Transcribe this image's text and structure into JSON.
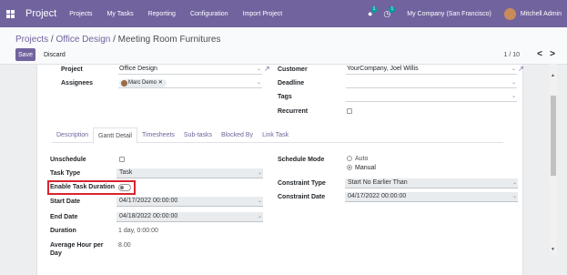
{
  "navbar": {
    "app_name": "Project",
    "menu": [
      "Projects",
      "My Tasks",
      "Reporting",
      "Configuration",
      "Import Project"
    ],
    "messages_badge": "1",
    "activity_badge": "1",
    "company": "My Company (San Francisco)",
    "user": "Mitchell Admin"
  },
  "control": {
    "breadcrumb_parent": "Projects",
    "breadcrumb_sep": " / ",
    "breadcrumb_middle": "Office Design",
    "breadcrumb_current": "Meeting Room Furnitures",
    "save_label": "Save",
    "discard_label": "Discard",
    "pager": "1 / 10",
    "prev": "<",
    "next": ">"
  },
  "form": {
    "project_label": "Project",
    "project_value": "Office Design",
    "assignees_label": "Assignees",
    "assignee_tag": "Marc Demo",
    "customer_label": "Customer",
    "customer_value": "YourCompany, Joel Willis",
    "deadline_label": "Deadline",
    "tags_label": "Tags",
    "recurrent_label": "Recurrent"
  },
  "tabs": [
    "Description",
    "Gantt Detail",
    "Timesheets",
    "Sub-tasks",
    "Blocked By",
    "Link Task"
  ],
  "gantt": {
    "unschedule_label": "Unschedule",
    "task_type_label": "Task Type",
    "task_type_value": "Task",
    "enable_duration_label": "Enable Task Duration",
    "start_date_label": "Start Date",
    "start_date_value": "04/17/2022 00:00:00",
    "end_date_label": "End Date",
    "end_date_value": "04/18/2022 00:00:00",
    "duration_label": "Duration",
    "duration_value": "1 day, 0:00:00",
    "avg_hour_label_1": "Average Hour per",
    "avg_hour_label_2": "Day",
    "avg_hour_value": "8.00",
    "schedule_mode_label": "Schedule Mode",
    "schedule_auto": "Auto",
    "schedule_manual": "Manual",
    "constraint_type_label": "Constraint Type",
    "constraint_type_value": "Start No Earlier Than",
    "constraint_date_label": "Constraint Date",
    "constraint_date_value": "04/17/2022 00:00:00"
  },
  "colors": {
    "brand": "#71639e",
    "highlight": "#d9232d"
  }
}
